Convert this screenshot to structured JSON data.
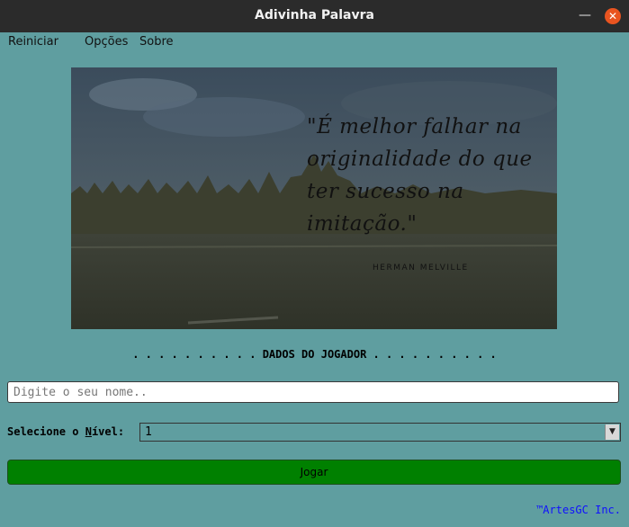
{
  "window": {
    "title": "Adivinha Palavra",
    "minimize_glyph": "—",
    "close_glyph": "✕",
    "accent_close": "#e95420"
  },
  "menu": {
    "items": [
      "Reiniciar",
      "Opções",
      "Sobre"
    ]
  },
  "banner": {
    "quote": "\"É melhor falhar na originalidade do que ter sucesso na imitação.\"",
    "author": "HERMAN MELVILLE"
  },
  "player_section": {
    "title": ". . . . . . . . . . DADOS DO JOGADOR . . . . . . . . . .",
    "name_value": "",
    "name_placeholder": "Digite o seu nome..",
    "level_label_before": "Selecione o ",
    "level_label_mnemonic": "N",
    "level_label_after": "ível:",
    "level_value": "1",
    "level_arrow_icon": "▼",
    "play_label": "Jogar",
    "play_color": "#008000"
  },
  "footer": {
    "credit": "™ArtesGC Inc."
  },
  "colors": {
    "background": "#5f9ea0",
    "titlebar": "#2b2b2b",
    "footer_text": "#1010ff"
  }
}
